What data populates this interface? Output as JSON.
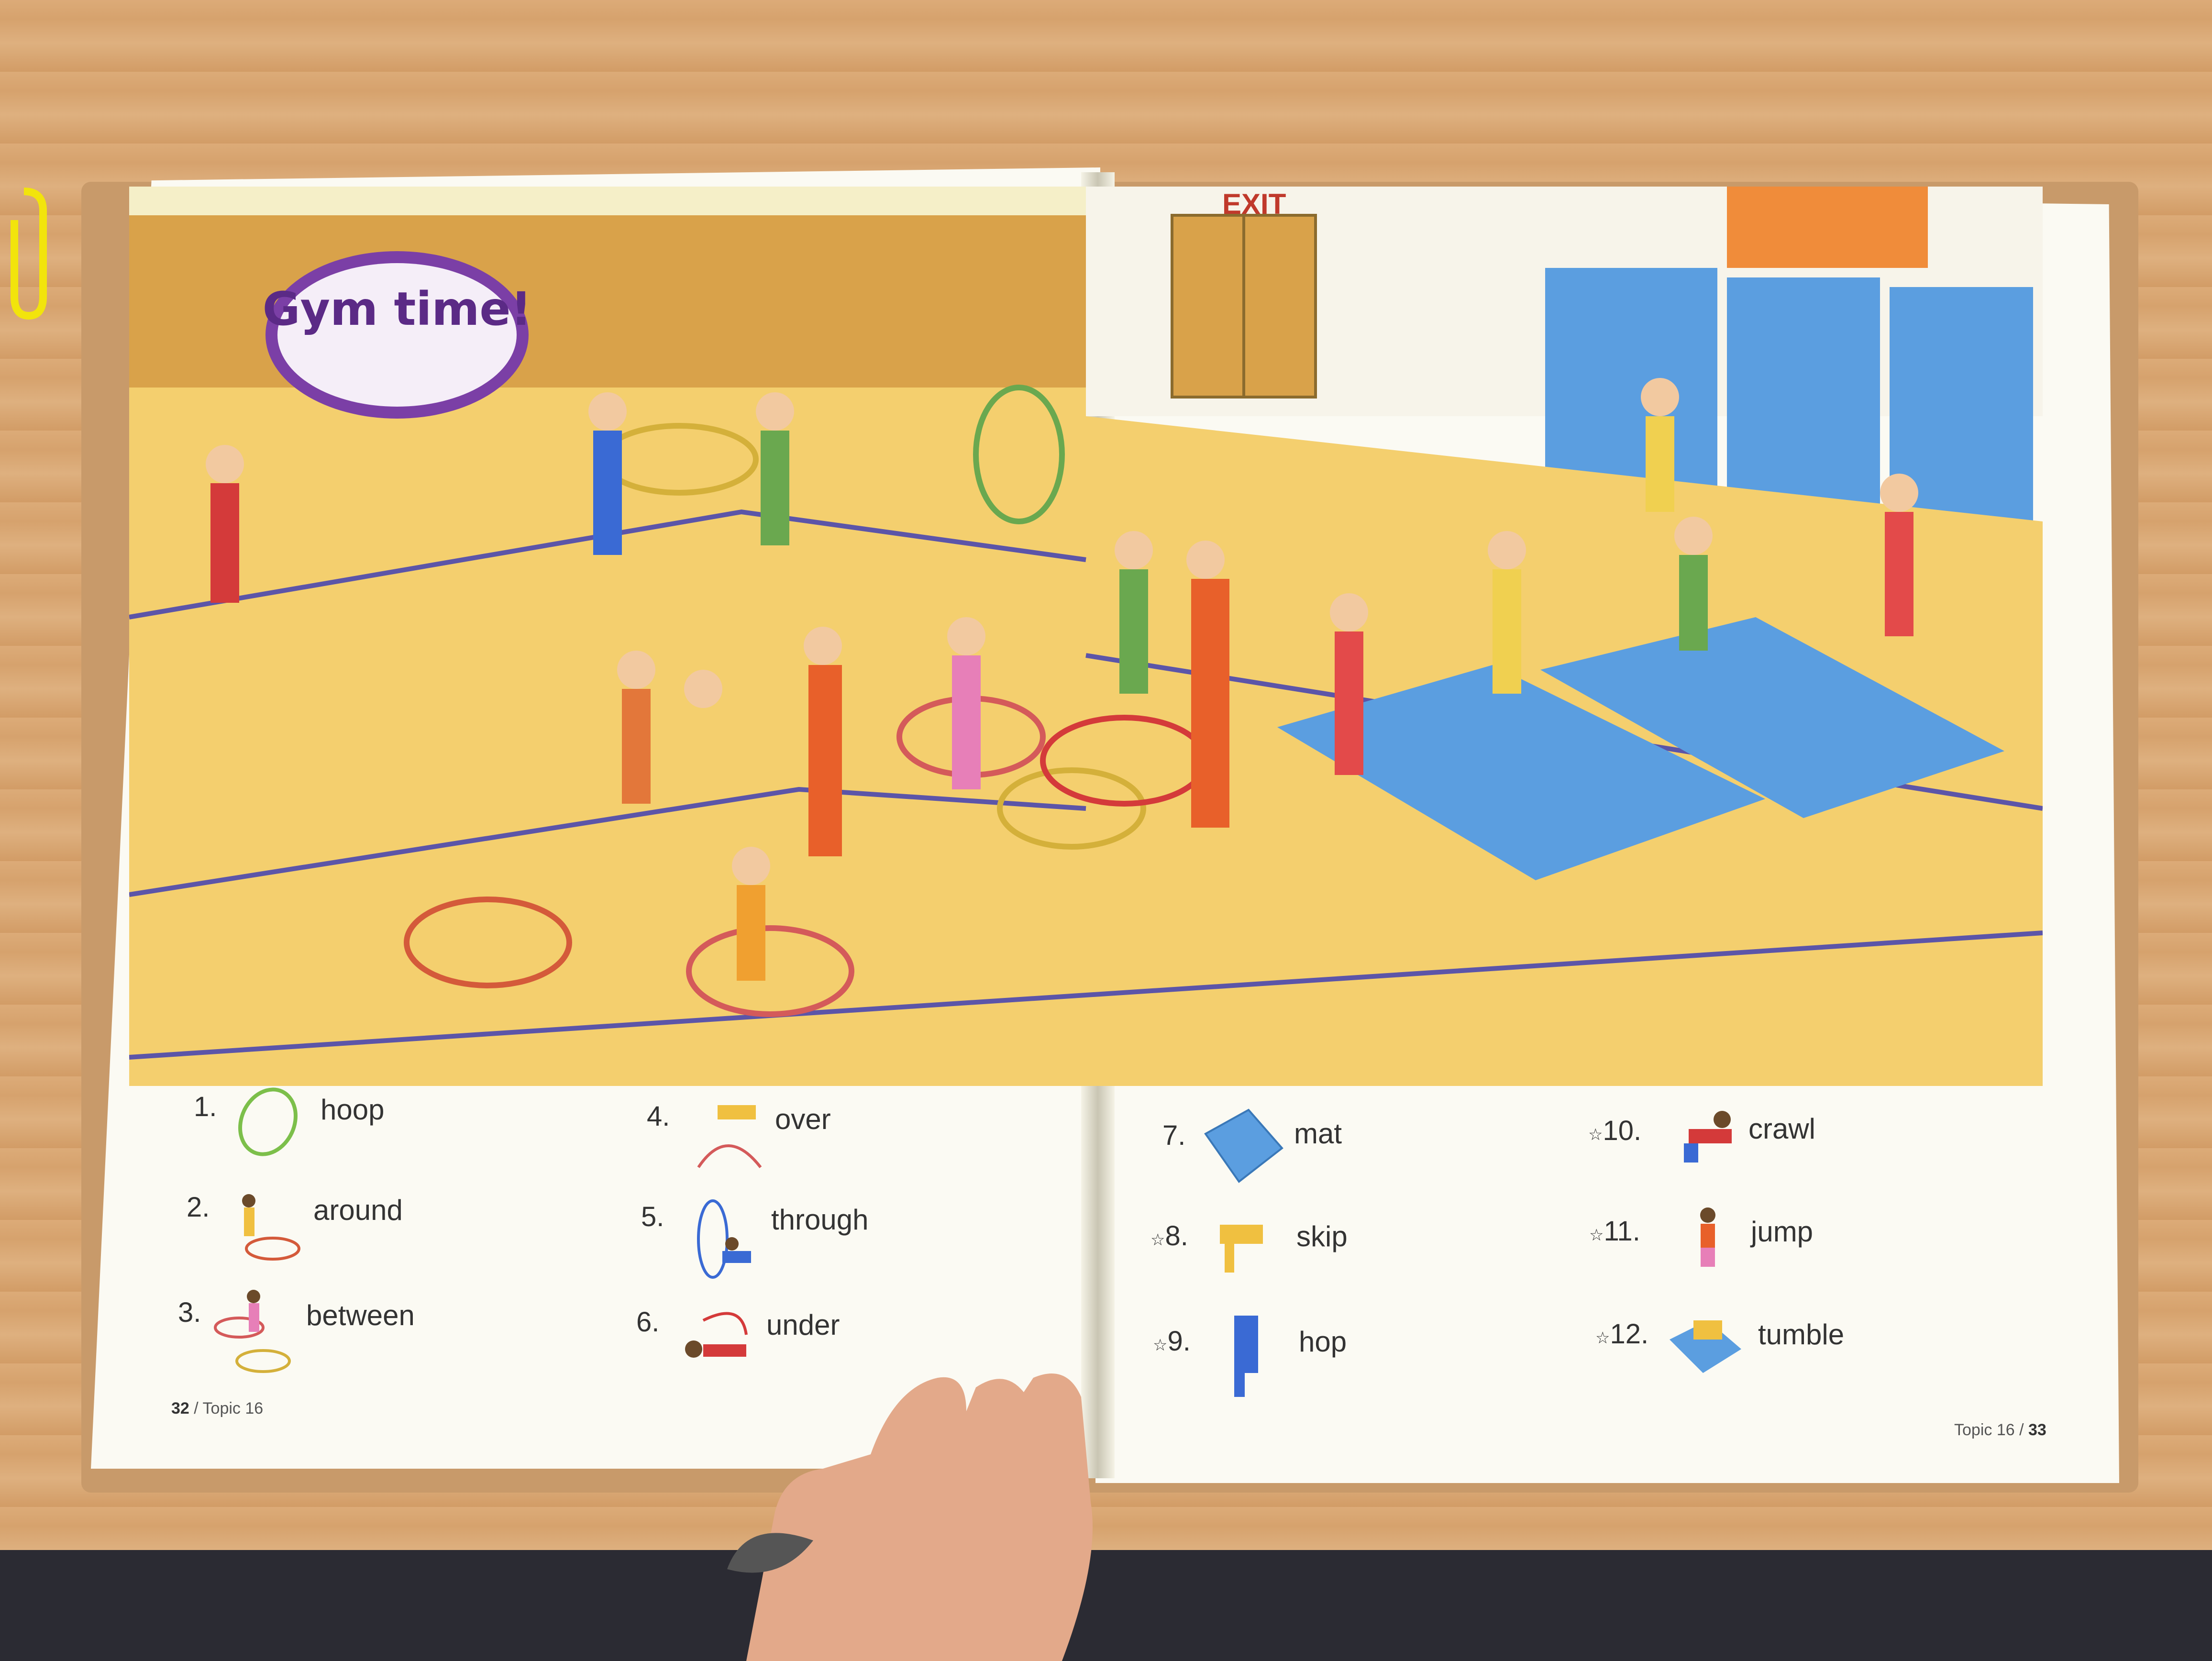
{
  "title": "Gym time!",
  "sign_exit": "EXIT",
  "vocab": [
    {
      "num": "1.",
      "word": "hoop",
      "icon": "hoop-icon"
    },
    {
      "num": "2.",
      "word": "around",
      "icon": "around-icon"
    },
    {
      "num": "3.",
      "word": "between",
      "icon": "between-icon"
    },
    {
      "num": "4.",
      "word": "over",
      "icon": "over-icon"
    },
    {
      "num": "5.",
      "word": "through",
      "icon": "through-icon"
    },
    {
      "num": "6.",
      "word": "under",
      "icon": "under-icon"
    },
    {
      "num": "7.",
      "word": "mat",
      "icon": "mat-icon"
    },
    {
      "num": "8.",
      "word": "skip",
      "icon": "skip-icon"
    },
    {
      "num": "9.",
      "word": "hop",
      "icon": "hop-icon"
    },
    {
      "num": "10.",
      "word": "crawl",
      "icon": "crawl-icon"
    },
    {
      "num": "11.",
      "word": "jump",
      "icon": "jump-icon"
    },
    {
      "num": "12.",
      "word": "tumble",
      "icon": "tumble-icon"
    }
  ],
  "star": "☆",
  "footer_left_num": "32",
  "footer_left_text": " / Topic 16",
  "footer_right_text": "Topic 16 / ",
  "footer_right_num": "33",
  "colors": {
    "title_purple": "#5b2a86",
    "floor_yellow": "#f4cf6e",
    "mat_blue": "#5b9ee0"
  }
}
